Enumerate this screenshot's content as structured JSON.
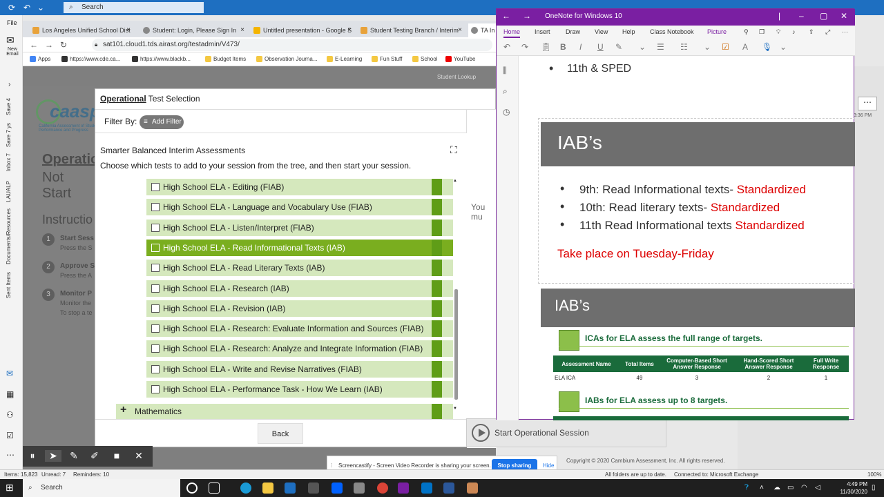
{
  "outlook": {
    "search_placeholder": "Search",
    "file_label": "File",
    "new_email_label": "New Email",
    "folders": [
      "Save 4",
      "Save 7 ys",
      "Inbox 7",
      "LAUALP",
      "Documents/Resources",
      "Sent Items"
    ],
    "status": {
      "items": "Items: 15,823",
      "unread": "Unread: 7",
      "reminders": "Reminders: 10",
      "folders": "All folders are up to date.",
      "connected": "Connected to: Microsoft Exchange",
      "zoom": "100%"
    }
  },
  "browser": {
    "tabs": [
      {
        "title": "Los Angeles Unified School Dist",
        "color": "#e8a23a"
      },
      {
        "title": "Student: Login, Please Sign In",
        "color": "#888"
      },
      {
        "title": "Untitled presentation - Google S",
        "color": "#f4b400"
      },
      {
        "title": "Student Testing Branch / Interim",
        "color": "#e8a23a"
      },
      {
        "title": "TA In",
        "color": "#888"
      }
    ],
    "url": "sat101.cloud1.tds.airast.org/testadmin/V473/",
    "bookmarks": [
      {
        "label": "Apps",
        "color": "#4285f4"
      },
      {
        "label": "https://www.cde.ca...",
        "color": "#333"
      },
      {
        "label": "https://www.blackb...",
        "color": "#333"
      },
      {
        "label": "Budget Items",
        "color": "#f4c842"
      },
      {
        "label": "Observation Journa...",
        "color": "#f4c842"
      },
      {
        "label": "E-Learning",
        "color": "#f4c842"
      },
      {
        "label": "Fun Stuff",
        "color": "#f4c842"
      },
      {
        "label": "School",
        "color": "#f4c842"
      },
      {
        "label": "YouTube",
        "color": "#e00"
      }
    ]
  },
  "page_bg": {
    "student_lookup": "Student Lookup",
    "title_partial": "Operatio",
    "subtitle_partial": "Not Start",
    "instructions_partial": "Instructio",
    "steps": [
      {
        "num": "1",
        "title": "Start Sess",
        "desc": "Press the S"
      },
      {
        "num": "2",
        "title": "Approve S",
        "desc": "Press the A"
      },
      {
        "num": "3",
        "title": "Monitor P",
        "desc": "Monitor the",
        "desc2": "To stop a te"
      }
    ],
    "logo_text": "caaspp",
    "logo_sub": "California Assessment of Student Performance and Progress"
  },
  "modal": {
    "title_bold": "Operational",
    "title_rest": " Test Selection",
    "filter_label": "Filter By:",
    "add_filter": "Add Filter",
    "section_title": "Smarter Balanced Interim Assessments",
    "section_sub": "Choose which tests to add to your session from the tree, and then start your session.",
    "you_must": "You mu",
    "tests": [
      {
        "label": "High School ELA - Editing (FIAB)",
        "selected": false
      },
      {
        "label": "High School ELA - Language and Vocabulary Use (FIAB)",
        "selected": false
      },
      {
        "label": "High School ELA - Listen/Interpret (FIAB)",
        "selected": false
      },
      {
        "label": "High School ELA - Read Informational Texts (IAB)",
        "selected": true
      },
      {
        "label": "High School ELA - Read Literary Texts (IAB)",
        "selected": false
      },
      {
        "label": "High School ELA - Research (IAB)",
        "selected": false
      },
      {
        "label": "High School ELA - Revision (IAB)",
        "selected": false
      },
      {
        "label": "High School ELA - Research: Evaluate Information and Sources (FIAB)",
        "selected": false
      },
      {
        "label": "High School ELA - Research: Analyze and Integrate Information (FIAB)",
        "selected": false
      },
      {
        "label": "High School ELA - Write and Revise Narratives (FIAB)",
        "selected": false
      },
      {
        "label": "High School ELA - Performance Task - How We Learn (IAB)",
        "selected": false
      }
    ],
    "math_label": "Mathematics",
    "back_label": "Back",
    "start_label": "Start Operational Session"
  },
  "onenote": {
    "title": "OneNote for Windows 10",
    "tabs": [
      "Home",
      "Insert",
      "Draw",
      "View",
      "Help",
      "Class Notebook",
      "Picture"
    ],
    "active_tab": "Home",
    "top_bullet": "11th & SPED",
    "iab_title": "IAB’s",
    "bullets": [
      {
        "text": "9th: Read Informational texts- ",
        "red": "Standardized"
      },
      {
        "text": "10th: Read literary texts- ",
        "red": "Standardized"
      },
      {
        "text": "11th Read Informational texts ",
        "red": "Standardized"
      }
    ],
    "red_note": "Take place on Tuesday-Friday",
    "iab_title2": "IAB’s",
    "ica_heading": "ICAs for ELA assess the full range of targets.",
    "ica_headers": [
      "Assessment Name",
      "Total Items",
      "Computer-Based Short Answer Response",
      "Hand-Scored Short Answer Response",
      "Full Write Response"
    ],
    "ica_row": [
      "ELA ICA",
      "49",
      "3",
      "2",
      "1"
    ],
    "iab_heading": "IABs for ELA assess up to 8 targets.",
    "accent": "#7a1fa2"
  },
  "screencastify": {
    "message": "Screencastify - Screen Video Recorder is sharing your screen.",
    "stop_label": "Stop sharing",
    "hide_label": "Hide"
  },
  "copyright": "Copyright © 2020 Cambium Assessment, Inc. All rights reserved.",
  "side_time": "3:36 PM",
  "taskbar": {
    "search_label": "Search",
    "time": "4:49 PM",
    "date": "11/30/2020"
  }
}
